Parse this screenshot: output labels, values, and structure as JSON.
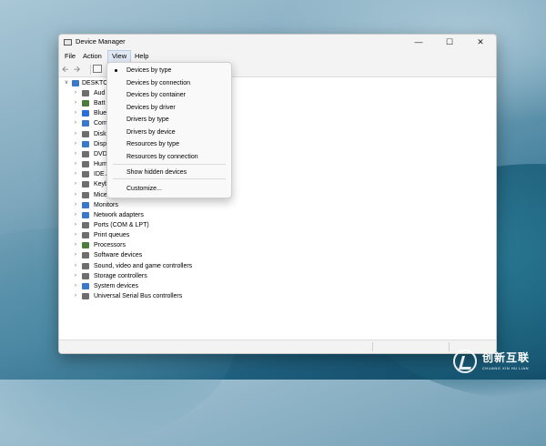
{
  "window": {
    "title": "Device Manager",
    "minimize_icon": "minimize-icon",
    "maximize_icon": "maximize-icon",
    "close_icon": "close-icon"
  },
  "menubar": {
    "items": [
      "File",
      "Action",
      "View",
      "Help"
    ],
    "active": "View"
  },
  "toolbar": {
    "icons": [
      "back-arrow-icon",
      "forward-arrow-icon",
      "properties-icon"
    ]
  },
  "tree": {
    "root": "DESKTO",
    "items": [
      {
        "label": "Aud",
        "icon": "audio-icon"
      },
      {
        "label": "Batt",
        "icon": "battery-icon"
      },
      {
        "label": "Blue",
        "icon": "bluetooth-icon"
      },
      {
        "label": "Com",
        "icon": "computer-icon"
      },
      {
        "label": "Disk",
        "icon": "disk-icon"
      },
      {
        "label": "Disp",
        "icon": "display-icon"
      },
      {
        "label": "DVD",
        "icon": "dvd-icon"
      },
      {
        "label": "Hum",
        "icon": "hid-icon"
      },
      {
        "label": "IDE A",
        "icon": "ide-icon"
      },
      {
        "label": "Keyb",
        "icon": "keyboard-icon"
      },
      {
        "label": "Mice and other pointing devices",
        "icon": "mouse-icon"
      },
      {
        "label": "Monitors",
        "icon": "monitor-icon"
      },
      {
        "label": "Network adapters",
        "icon": "network-icon"
      },
      {
        "label": "Ports (COM & LPT)",
        "icon": "port-icon"
      },
      {
        "label": "Print queues",
        "icon": "printer-icon"
      },
      {
        "label": "Processors",
        "icon": "processor-icon"
      },
      {
        "label": "Software devices",
        "icon": "software-icon"
      },
      {
        "label": "Sound, video and game controllers",
        "icon": "sound-icon"
      },
      {
        "label": "Storage controllers",
        "icon": "storage-icon"
      },
      {
        "label": "System devices",
        "icon": "system-icon"
      },
      {
        "label": "Universal Serial Bus controllers",
        "icon": "usb-icon"
      }
    ]
  },
  "view_menu": {
    "items": [
      {
        "label": "Devices by type",
        "checked": true
      },
      {
        "label": "Devices by connection",
        "checked": false
      },
      {
        "label": "Devices by container",
        "checked": false
      },
      {
        "label": "Devices by driver",
        "checked": false
      },
      {
        "label": "Drivers by type",
        "checked": false
      },
      {
        "label": "Drivers by device",
        "checked": false
      },
      {
        "label": "Resources by type",
        "checked": false
      },
      {
        "label": "Resources by connection",
        "checked": false
      },
      {
        "label": "Show hidden devices",
        "checked": false
      },
      {
        "label": "Customize...",
        "checked": false
      }
    ]
  },
  "watermark": {
    "text": "创新互联",
    "sub": "CHUANG XIN HU LIAN"
  },
  "colors": {
    "folder": "#e8b74a",
    "accent_blue": "#3c78c8",
    "menu_active_bg": "#dfe8f3"
  }
}
